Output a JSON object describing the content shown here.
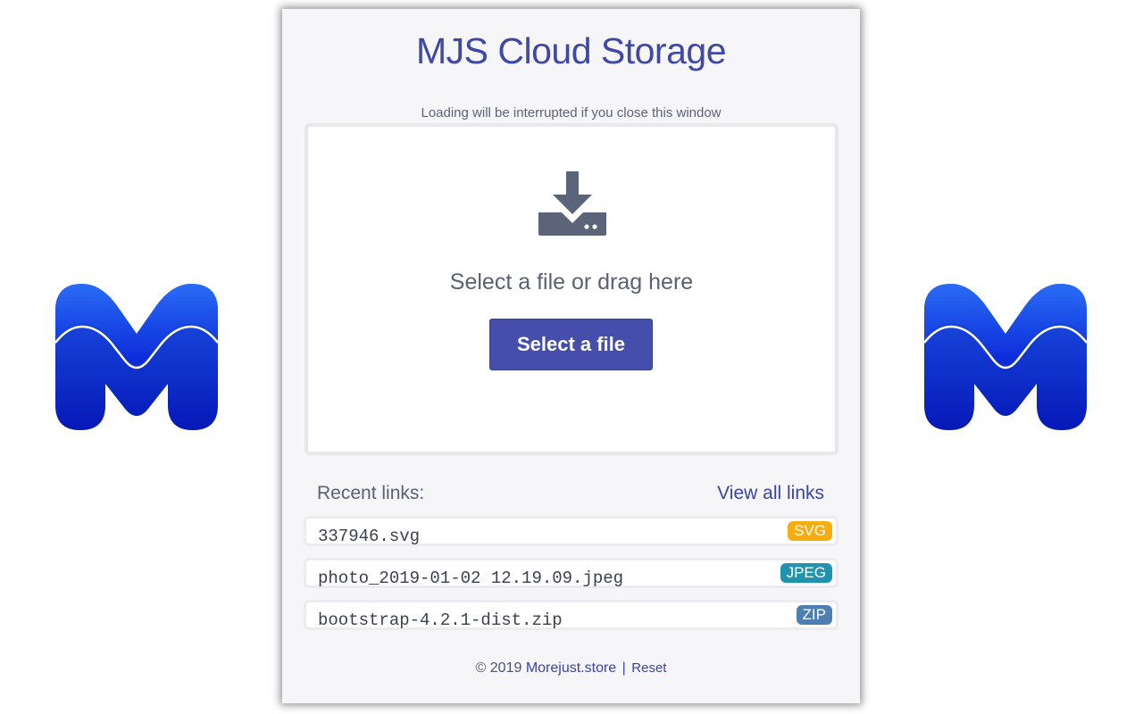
{
  "app": {
    "title": "MJS Cloud Storage",
    "notice": "Loading will be interrupted if you close this window"
  },
  "dropzone": {
    "icon": "download-tray-icon",
    "text": "Select a file or drag here",
    "button_label": "Select a file"
  },
  "recent": {
    "label": "Recent links:",
    "view_all": "View all links",
    "items": [
      {
        "name": "337946.svg",
        "badge": "SVG",
        "badge_color": "#f5ad12"
      },
      {
        "name": "photo_2019-01-02 12.19.09.jpeg",
        "badge": "JPEG",
        "badge_color": "#2193ae"
      },
      {
        "name": "bootstrap-4.2.1-dist.zip",
        "badge": "ZIP",
        "badge_color": "#4f7fb0"
      }
    ]
  },
  "footer": {
    "copyright": "© 2019",
    "site_link": "Morejust.store",
    "separator": "|",
    "reset": "Reset"
  },
  "colors": {
    "accent": "#3f48a5",
    "button": "#454eab",
    "logo_blue": "#0a3fe0"
  }
}
